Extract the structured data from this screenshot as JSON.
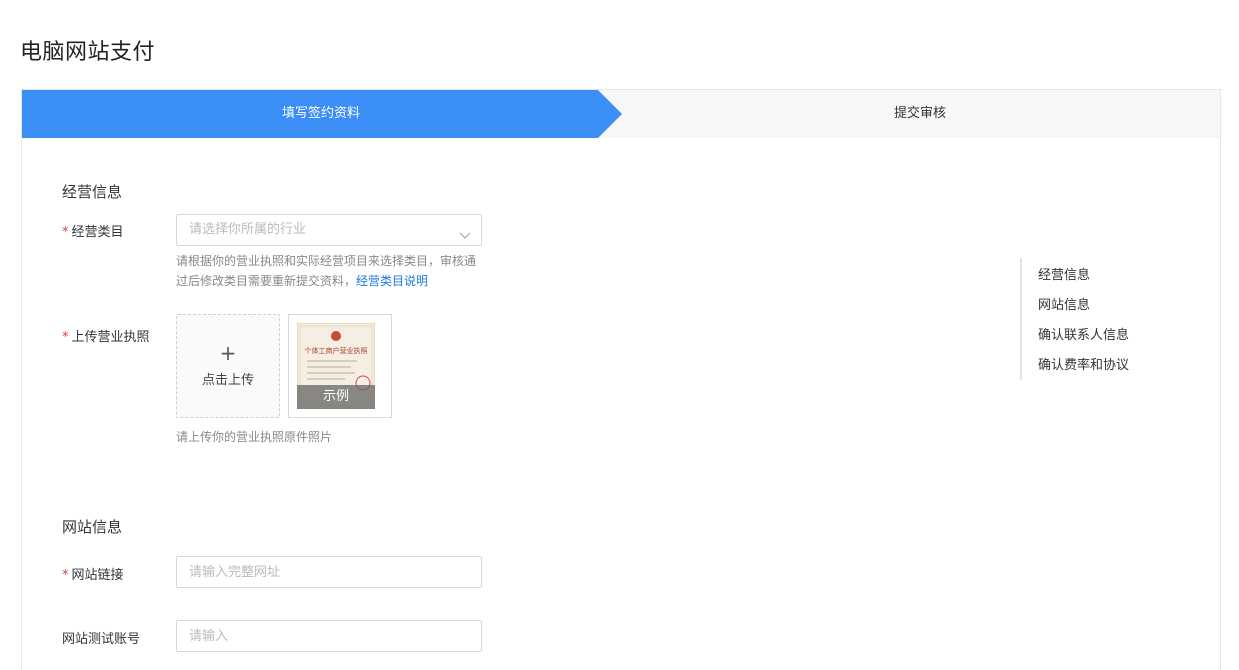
{
  "page": {
    "title": "电脑网站支付"
  },
  "steps": [
    {
      "label": "填写签约资料",
      "active": true
    },
    {
      "label": "提交审核",
      "active": false
    }
  ],
  "colors": {
    "accent": "#3a8ef6",
    "required": "#e0393e",
    "link": "#1e7be0"
  },
  "business_section": {
    "title": "经营信息",
    "category": {
      "required_mark": "*",
      "label": "经营类目",
      "placeholder": "请选择你所属的行业",
      "hint_line1": "请根据你的营业执照和实际经营项目来选择类目，审核通",
      "hint_line2": "过后修改类目需要重新提交资料，",
      "hint_link": "经营类目说明"
    },
    "license": {
      "required_mark": "*",
      "label": "上传营业执照",
      "upload_plus": "+",
      "upload_text": "点击上传",
      "example_caption": "示例",
      "example_image_title": "个体工商户营业执照",
      "hint": "请上传你的营业执照原件照片"
    }
  },
  "website_section": {
    "title": "网站信息",
    "url": {
      "required_mark": "*",
      "label": "网站链接",
      "placeholder": "请输入完整网址",
      "value": ""
    },
    "test_account": {
      "label": "网站测试账号",
      "placeholder": "请输入",
      "value": ""
    }
  },
  "side_nav": {
    "items": [
      "经营信息",
      "网站信息",
      "确认联系人信息",
      "确认费率和协议"
    ]
  }
}
